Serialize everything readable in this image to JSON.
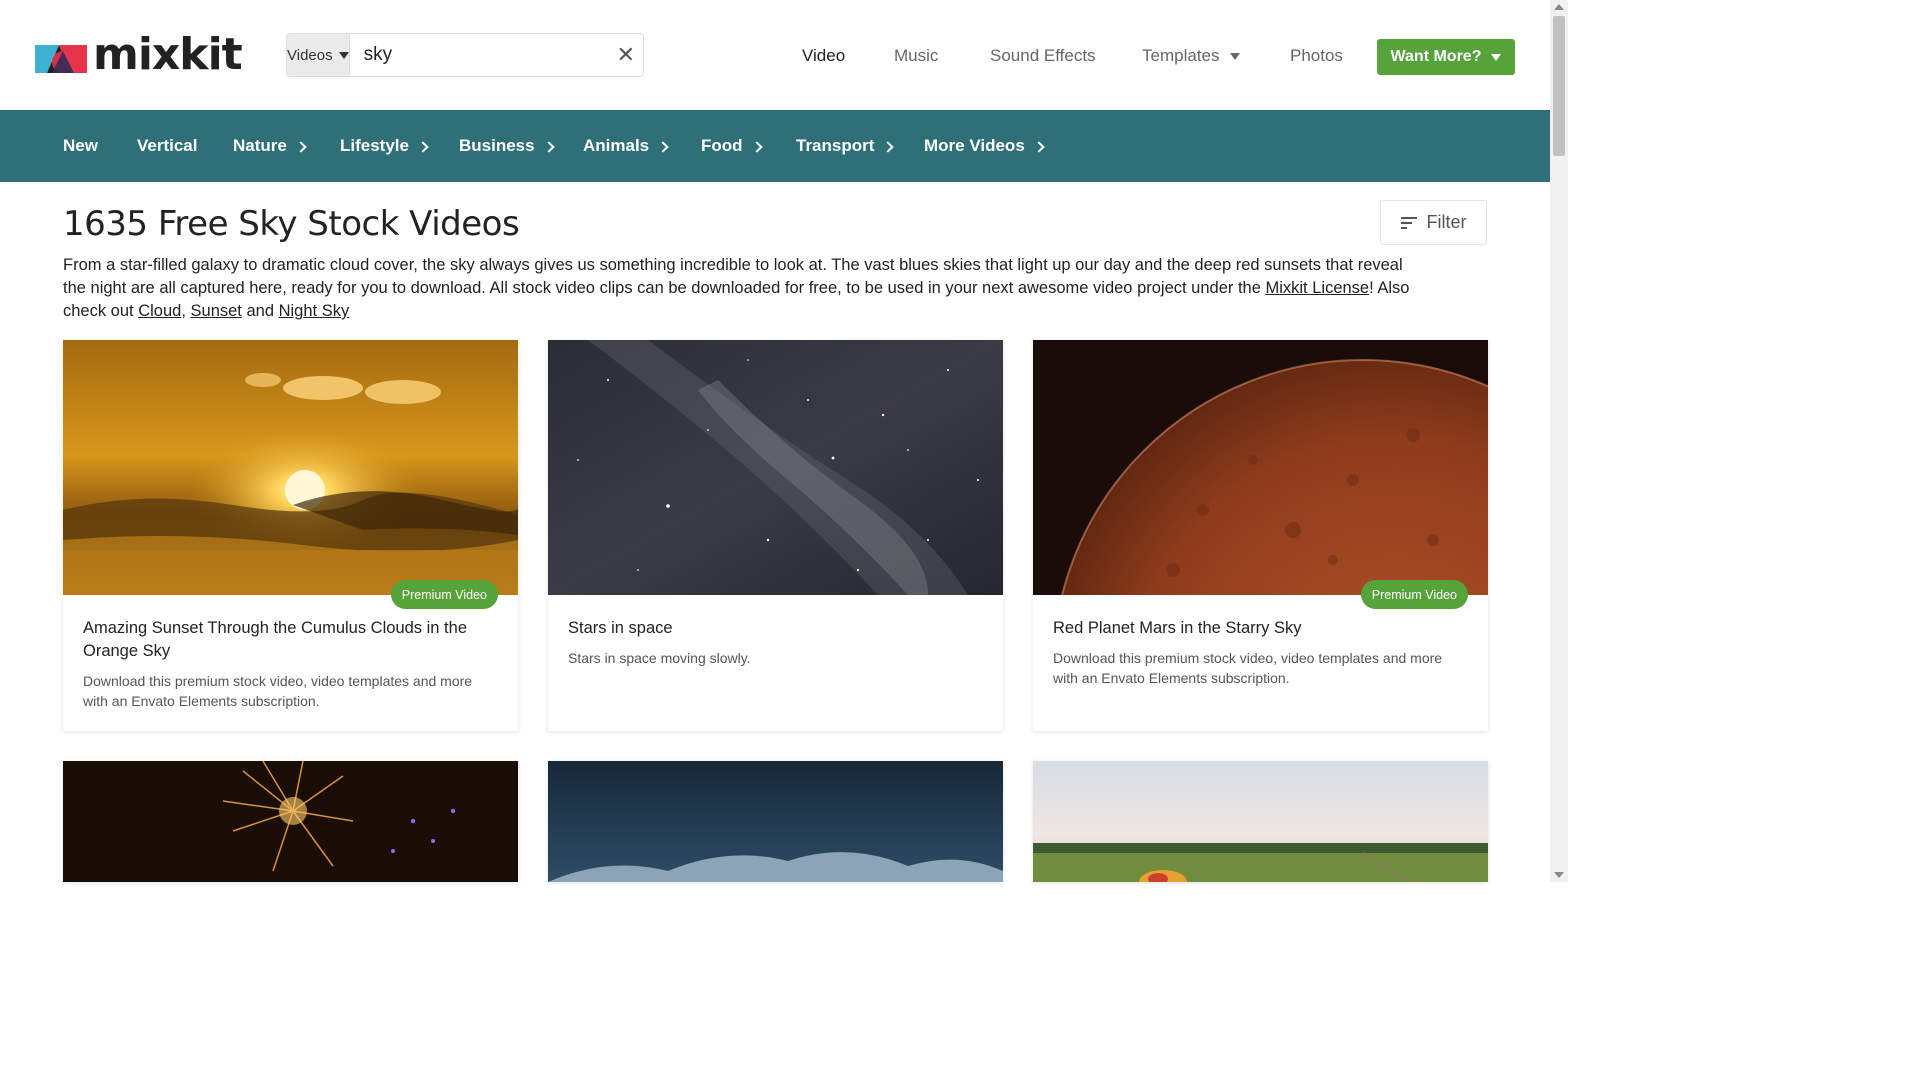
{
  "header": {
    "logo_text": "mixkit",
    "search": {
      "category": "Videos",
      "query": "sky",
      "clear_glyph": "✕"
    },
    "nav": [
      "Video",
      "Music",
      "Sound Effects",
      "Templates",
      "Photos"
    ],
    "active_nav": "Video",
    "want_more": "Want More?"
  },
  "categories": [
    "New",
    "Vertical",
    "Nature",
    "Lifestyle",
    "Business",
    "Animals",
    "Food",
    "Transport",
    "More Videos"
  ],
  "main": {
    "title": "1635 Free Sky Stock Videos",
    "filter_label": "Filter",
    "description": {
      "text_1": "From a star-filled galaxy to dramatic cloud cover, the sky always gives us something incredible to look at. The vast blues skies that light up our day and the deep red sunsets that reveal the night are all captured here, ready for you to download. All stock video clips can be downloaded for free, to be used in your next awesome video project under the ",
      "license_link": "Mixkit License",
      "text_2": "! Also check out ",
      "link_cloud": "Cloud",
      "comma": ", ",
      "link_sunset": "Sunset",
      "and": " and ",
      "link_night_sky": "Night Sky"
    }
  },
  "cards": [
    {
      "title": "Amazing Sunset Through the Cumulus Clouds in the Orange Sky",
      "description": "Download this premium stock video, video templates and more with an Envato Elements subscription.",
      "badge": "Premium Video"
    },
    {
      "title": "Stars in space",
      "description": "Stars in space moving slowly.",
      "badge": ""
    },
    {
      "title": "Red Planet Mars in the Starry Sky",
      "description": "Download this premium stock video, video templates and more with an Envato Elements subscription.",
      "badge": "Premium Video"
    }
  ],
  "colors": {
    "brand_green": "#56a33a",
    "category_bar": "#2e6f78"
  }
}
